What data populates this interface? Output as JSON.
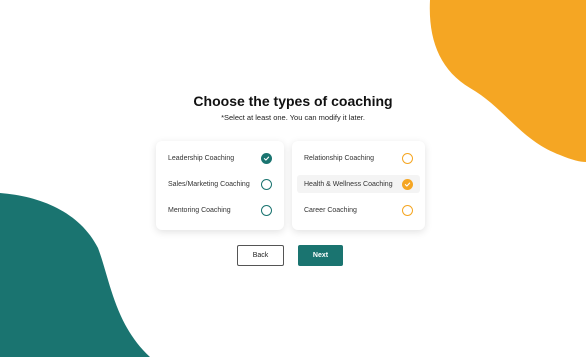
{
  "heading": "Choose the types of coaching",
  "subheading": "*Select at least one. You can modify it later.",
  "colors": {
    "teal": "#1a7470",
    "orange": "#f5a623"
  },
  "left_options": [
    {
      "label": "Leadership Coaching",
      "checked": true
    },
    {
      "label": "Sales/Marketing Coaching",
      "checked": false
    },
    {
      "label": "Mentoring Coaching",
      "checked": false
    }
  ],
  "right_options": [
    {
      "label": "Relationship Coaching",
      "checked": false
    },
    {
      "label": "Health & Wellness Coaching",
      "checked": true
    },
    {
      "label": "Career Coaching",
      "checked": false
    }
  ],
  "buttons": {
    "back": "Back",
    "next": "Next"
  }
}
